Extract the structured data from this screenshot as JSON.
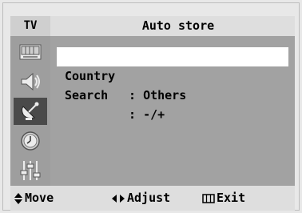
{
  "header": {
    "tv_label": "TV",
    "title": "Auto store"
  },
  "sidebar": {
    "items": [
      {
        "icon": "picture-icon"
      },
      {
        "icon": "sound-icon"
      },
      {
        "icon": "channel-icon",
        "active": true
      },
      {
        "icon": "clock-icon"
      },
      {
        "icon": "setup-icon"
      }
    ]
  },
  "menu": {
    "rows": [
      {
        "label": "Country",
        "sep": ":",
        "value": "Others",
        "selected": true
      },
      {
        "label": "Search",
        "sep": ":",
        "value": "-/+",
        "selected": false
      }
    ]
  },
  "footer": {
    "move": "Move",
    "adjust": "Adjust",
    "exit": "Exit"
  },
  "colors": {
    "sidebar_bg": "#9e9e9e",
    "content_bg": "#a2a2a2",
    "active_item_bg": "#4a4a4a",
    "bar_bg": "#dedede"
  }
}
